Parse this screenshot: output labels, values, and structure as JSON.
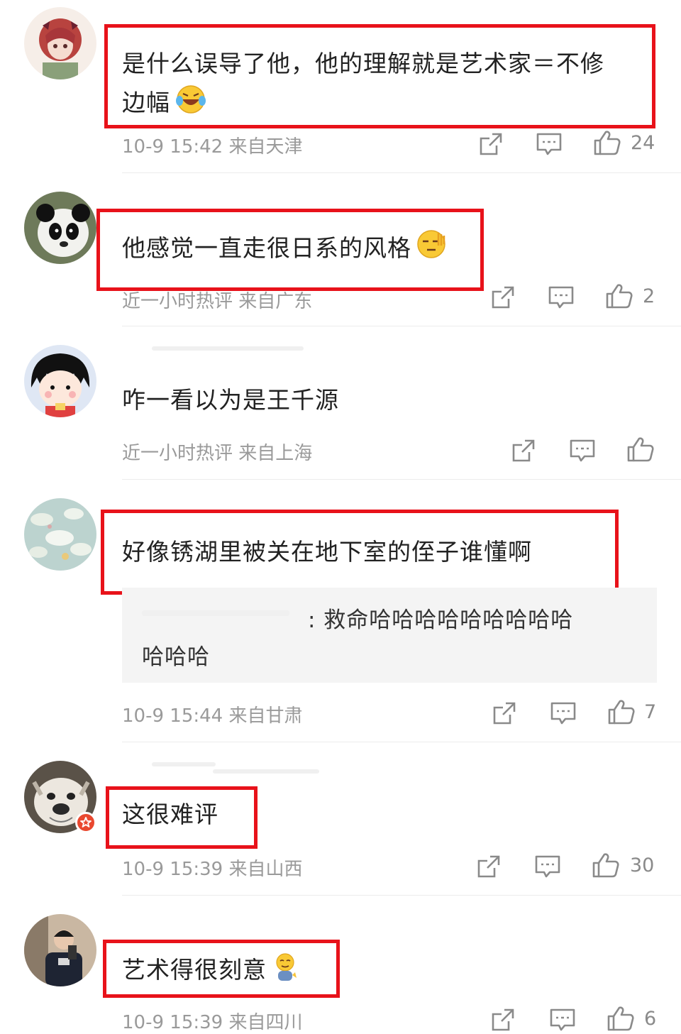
{
  "comments": [
    {
      "text_line1": "是什么误导了他，他的理解就是艺术家＝不修",
      "text_line2": "边幅",
      "meta": "10-9 15:42  来自天津",
      "likes": "24"
    },
    {
      "text": "他感觉一直走很日系的风格",
      "meta": "近一小时热评  来自广东",
      "likes": "2"
    },
    {
      "text": "咋一看以为是王千源",
      "meta": "近一小时热评  来自上海",
      "likes": ""
    },
    {
      "text": "好像锈湖里被关在地下室的侄子谁懂啊",
      "reply_line1": ": 救命哈哈哈哈哈哈哈哈哈",
      "reply_line2": "哈哈哈",
      "meta": "10-9 15:44  来自甘肃",
      "likes": "7"
    },
    {
      "text": "这很难评",
      "meta": "10-9 15:39  来自山西",
      "likes": "30"
    },
    {
      "text": "艺术得很刻意",
      "meta": "10-9 15:39  来自四川",
      "likes": "6"
    }
  ],
  "icons": {
    "share": "share-icon",
    "comment": "comment-icon",
    "like": "thumbs-up-icon"
  },
  "colors": {
    "highlight": "#e8121a",
    "meta_text": "#9a9a9a",
    "badge": "#e9482f"
  }
}
